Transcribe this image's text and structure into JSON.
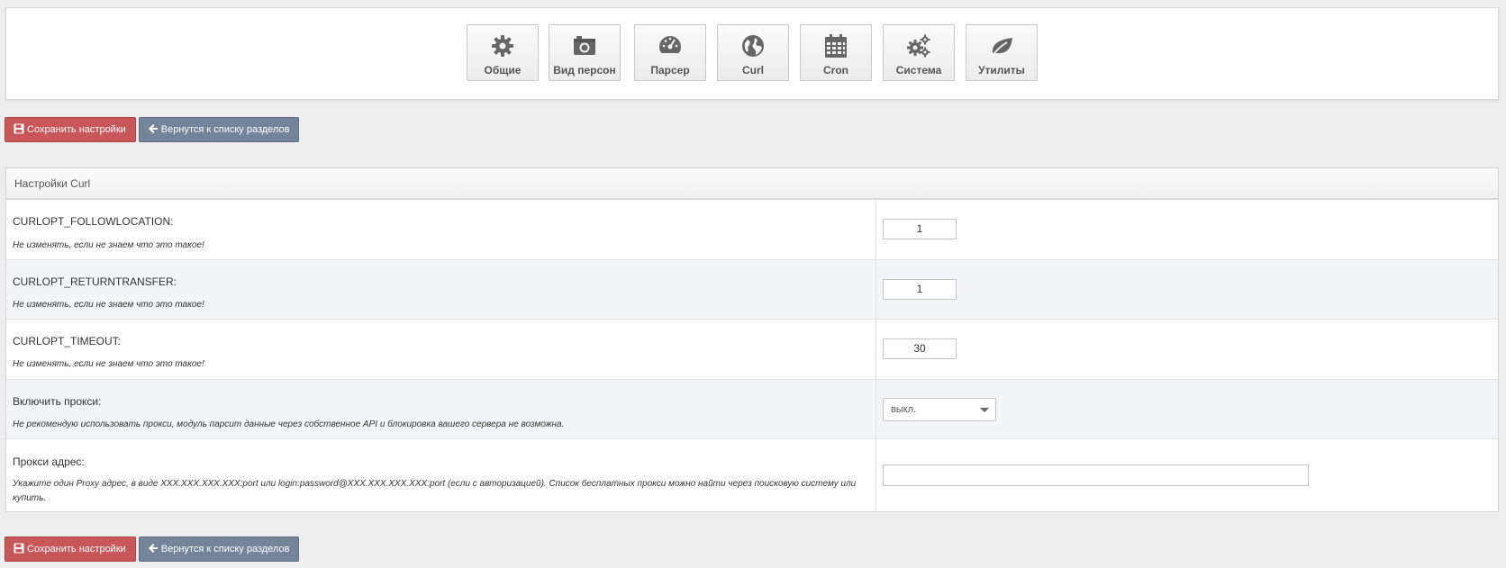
{
  "nav": {
    "items": [
      {
        "label": "Общие",
        "icon": "gear-icon"
      },
      {
        "label": "Вид персон",
        "icon": "camera-icon"
      },
      {
        "label": "Парсер",
        "icon": "dashboard-icon"
      },
      {
        "label": "Curl",
        "icon": "globe-icon"
      },
      {
        "label": "Cron",
        "icon": "calendar-icon"
      },
      {
        "label": "Система",
        "icon": "gears-icon"
      },
      {
        "label": "Утилиты",
        "icon": "leaf-icon"
      }
    ]
  },
  "actions": {
    "save_label": "Сохранить настройки",
    "back_label": "Вернутся к списку разделов"
  },
  "panel": {
    "title": "Настройки Curl",
    "rows": [
      {
        "title": "CURLOPT_FOLLOWLOCATION:",
        "desc": "Не изменять, если не знаем что это такое!",
        "value": "1"
      },
      {
        "title": "CURLOPT_RETURNTRANSFER:",
        "desc": "Не изменять, если не знаем что это такое!",
        "value": "1"
      },
      {
        "title": "CURLOPT_TIMEOUT:",
        "desc": "Не изменять, если не знаем что это такое!",
        "value": "30"
      },
      {
        "title": "Включить прокси:",
        "desc": "Не рекомендую использовать прокси, модуль парсит данные через собственное API и блокировка вашего сервера не возможна.",
        "value": "выкл."
      },
      {
        "title": "Прокси адрес:",
        "desc": "Укажите один Proxy адрес, в виде XXX.XXX.XXX.XXX:port или login:password@XXX.XXX.XXX.XXX:port (если с авторизацией). Список бесплатных прокси можно найти через поисковую систему или купить.",
        "value": ""
      }
    ]
  },
  "colors": {
    "save": "#c8575a",
    "back": "#74849a",
    "background": "#eeeeee"
  }
}
